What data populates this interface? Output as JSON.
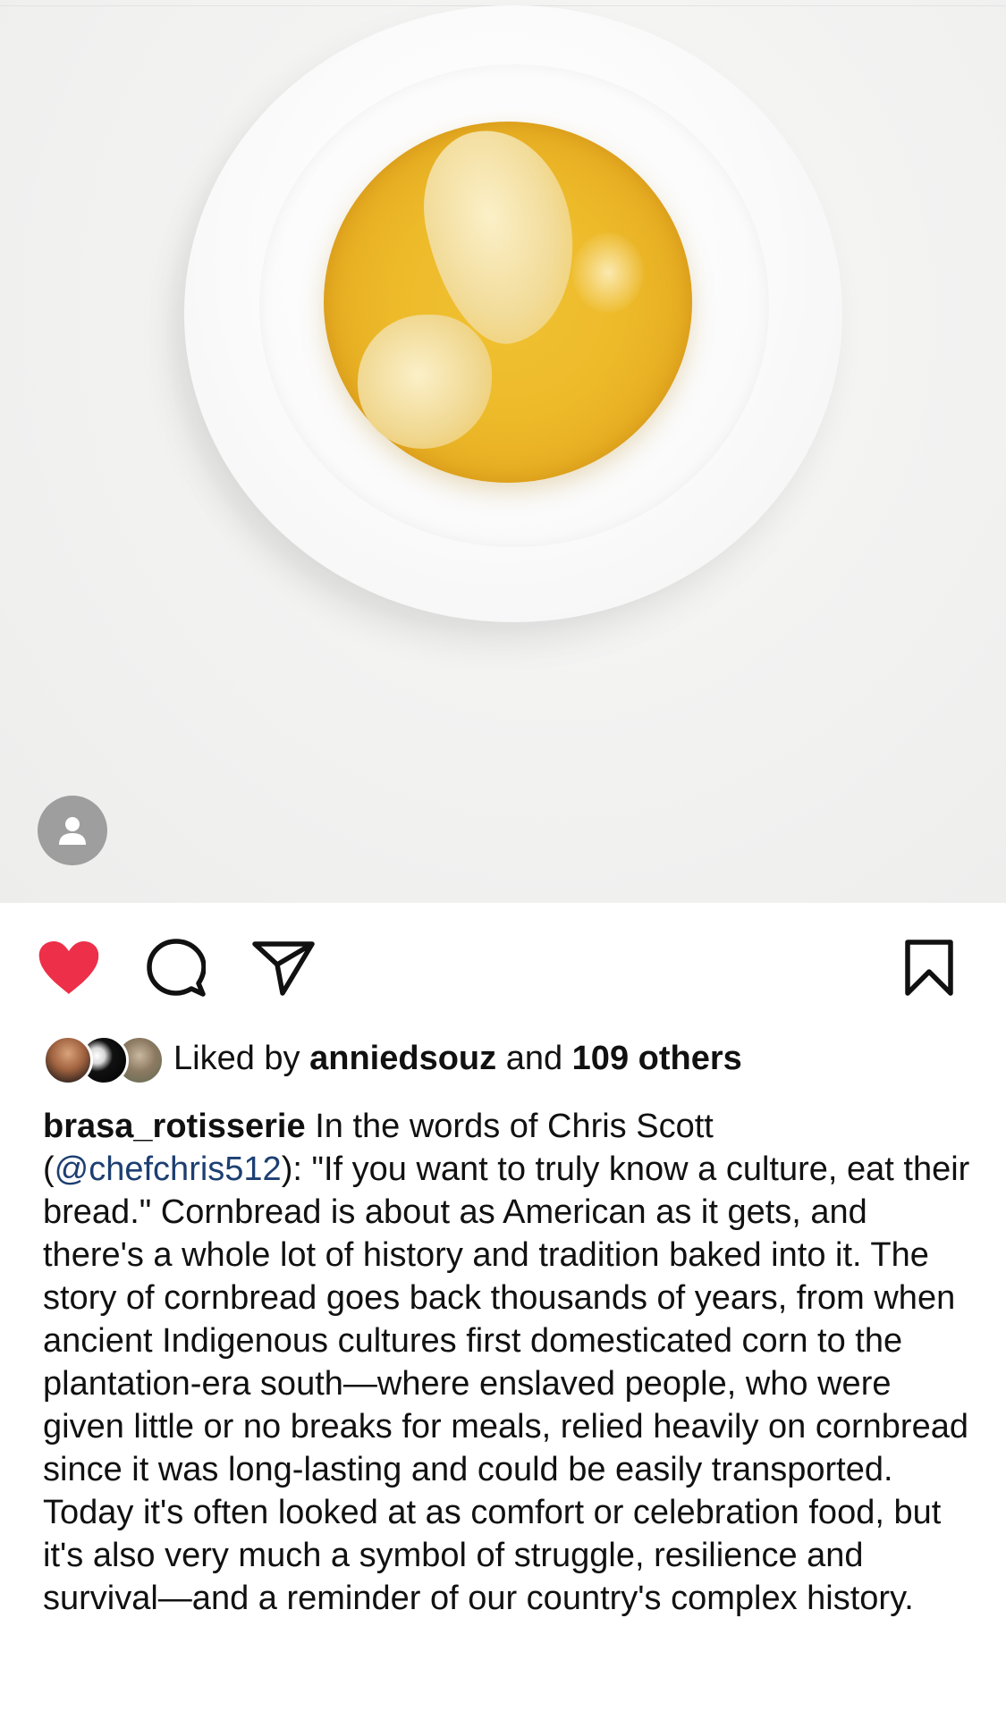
{
  "post": {
    "image_alt_icons": {
      "user_tag_icon": "person-icon"
    }
  },
  "actions": {
    "like_icon": "heart-filled-icon",
    "comment_icon": "comment-icon",
    "share_icon": "paper-plane-icon",
    "save_icon": "bookmark-icon",
    "like_color": "#ed2f49"
  },
  "likes": {
    "prefix": "Liked by",
    "first_liker": "anniedsouz",
    "connector": "and",
    "others": "109 others"
  },
  "caption": {
    "username": "brasa_rotisserie",
    "text_before_mention": "In the words of Chris Scott (",
    "mention": "@chefchris512",
    "text_after_mention": "): \"If you want to truly know a culture, eat their bread.\" Cornbread is about as American as it gets, and there's a whole lot of history and tradition baked into it. The story of cornbread goes back thousands of years, from when ancient Indigenous cultures first domesticated corn to the plantation-era south—where enslaved people, who were given little or no breaks for meals, relied heavily on cornbread since it was long-lasting and could be easily transported. Today it's often looked at as comfort or celebration food, but it's also very much a symbol of struggle, resilience and survival—and a reminder of our country's complex history."
  },
  "colors": {
    "mention": "#1d3f72",
    "text": "#111111",
    "user_tag_bg": "#9e9e9e"
  }
}
